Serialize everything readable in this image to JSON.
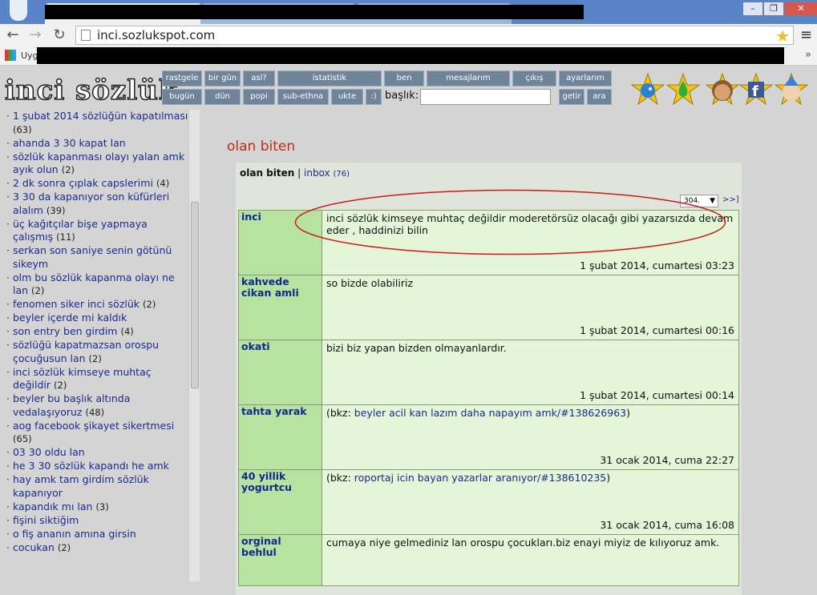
{
  "browser": {
    "url": "inci.sozlukspot.com",
    "bookmarks_apps_label": "Uyg",
    "bookmarks_more": "»"
  },
  "site": {
    "logo": "inci sözlük",
    "menu_row1": [
      "rastgele",
      "bir gün",
      "asl?",
      "istatistik",
      "ben",
      "mesajlarım",
      "çıkış",
      "ayarlarım"
    ],
    "menu_row2": [
      "bugün",
      "dün",
      "popi",
      "sub-ethna",
      "ukte",
      ":)"
    ],
    "search_label": "başlık:",
    "search_placeholder": "",
    "search_buttons": [
      "getir",
      "ara"
    ],
    "header_icons": [
      "bird-icon",
      "green-drop-icon",
      "face-avatar-icon",
      "facebook-icon",
      "cartoon-face-icon"
    ]
  },
  "sidebar": {
    "items": [
      {
        "title": "1 şubat 2014 sözlüğün kapatılması",
        "count": "(63)"
      },
      {
        "title": "ahanda 3 30 kapat lan",
        "count": ""
      },
      {
        "title": "sözlük kapanması olayı yalan amk ayık olun",
        "count": "(2)"
      },
      {
        "title": "2 dk sonra çıplak capslerimi",
        "count": "(4)"
      },
      {
        "title": "3 30 da kapanıyor son küfürleri alalım",
        "count": "(39)"
      },
      {
        "title": "üç kağıtçılar bişe yapmaya çalışmış",
        "count": "(11)"
      },
      {
        "title": "serkan son saniye senin götünü sikeym",
        "count": ""
      },
      {
        "title": "olm bu sözlük kapanma olayı ne lan",
        "count": "(2)"
      },
      {
        "title": "fenomen siker inci sözlük",
        "count": "(2)"
      },
      {
        "title": "beyler içerde mi kaldık",
        "count": ""
      },
      {
        "title": "son entry ben girdim",
        "count": "(4)"
      },
      {
        "title": "sözlüğü kapatmazsan orospu çocuğusun lan",
        "count": "(2)"
      },
      {
        "title": "inci sözlük kimseye muhtaç değildir",
        "count": "(2)"
      },
      {
        "title": "beyler bu başlık altında vedalaşıyoruz",
        "count": "(48)"
      },
      {
        "title": "aog facebook şikayet sikertmesi",
        "count": "(65)"
      },
      {
        "title": "03 30 oldu lan",
        "count": ""
      },
      {
        "title": "he 3 30 sözlük kapandı he amk",
        "count": ""
      },
      {
        "title": "hay amk tam girdim sözlük kapanıyor",
        "count": ""
      },
      {
        "title": "kapandık mı lan",
        "count": "(3)"
      },
      {
        "title": "fişini siktiğim",
        "count": ""
      },
      {
        "title": "o fiş ananın amına girsin",
        "count": ""
      },
      {
        "title": "cocukan",
        "count": "(2)"
      }
    ]
  },
  "main": {
    "title": "olan biten",
    "tab_active": "olan biten",
    "tab_separator": "|",
    "tab_inbox": "inbox",
    "inbox_count": "(76)",
    "pager_value": "304.",
    "pager_next": ">>]",
    "entries": [
      {
        "author": "inci",
        "text": "inci sözlük kimseye muhtaç değildir moderetörsüz olacağı gibi yazarsızda devam eder , haddinizi bilin",
        "bkz": "",
        "date": "1 şubat 2014, cumartesi 03:23"
      },
      {
        "author": "kahvede cikan amli",
        "text": "so bizde olabiliriz",
        "bkz": "",
        "date": "1 şubat 2014, cumartesi 00:16"
      },
      {
        "author": "okati",
        "text": "bizi biz yapan bizden olmayanlardır.",
        "bkz": "",
        "date": "1 şubat 2014, cumartesi 00:14"
      },
      {
        "author": "tahta yarak",
        "text": "(bkz: ",
        "bkz": "beyler acil kan lazım daha napayım amk/#138626963",
        "bkz_close": ")",
        "date": "31 ocak 2014, cuma 22:27"
      },
      {
        "author": "40 yillik yogurtcu",
        "text": "(bkz: ",
        "bkz": "roportaj icin bayan yazarlar aranıyor/#138610235",
        "bkz_close": ")",
        "date": "31 ocak 2014, cuma 16:08"
      },
      {
        "author": "orginal behlul",
        "text": "cumaya niye gelmediniz lan orospu çocukları.biz enayi miyiz de kılıyoruz amk.",
        "bkz": "",
        "date": ""
      }
    ]
  },
  "colors": {
    "accent_title": "#c02a10",
    "link": "#1a2b8f",
    "author_cell": "#b8e2a0",
    "content_cell": "#e4f5d8",
    "highlight": "#d01818"
  }
}
